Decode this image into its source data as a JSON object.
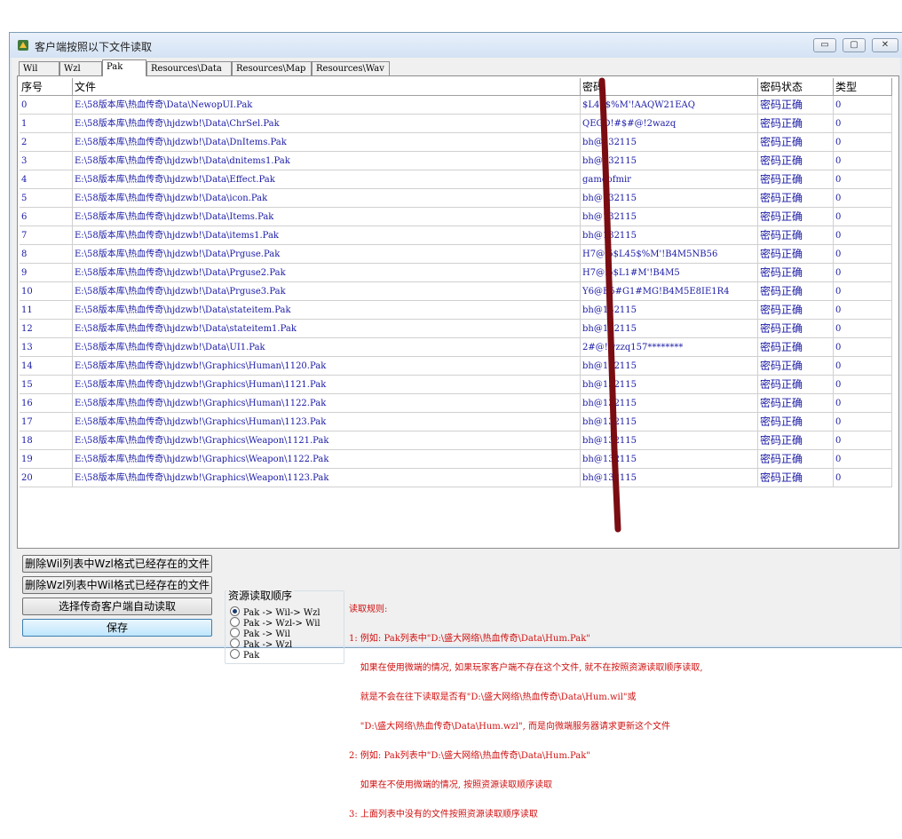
{
  "window": {
    "title": "客户端按照以下文件读取",
    "controls": {
      "minimize": "▭",
      "maximize": "▢",
      "close": "✕"
    }
  },
  "tabs": [
    {
      "label": "Wil",
      "active": false
    },
    {
      "label": "Wzl",
      "active": false
    },
    {
      "label": "Pak",
      "active": true
    },
    {
      "label": "Resources\\Data",
      "active": false
    },
    {
      "label": "Resources\\Map",
      "active": false
    },
    {
      "label": "Resources\\Wav",
      "active": false
    }
  ],
  "table": {
    "headers": [
      "序号",
      "文件",
      "密码",
      "密码状态",
      "类型"
    ],
    "rows": [
      [
        "0",
        "E:\\58版本库\\热血传奇\\Data\\NewopUI.Pak",
        "$L45$%M'!AAQW21EAQ",
        "密码正确",
        "0"
      ],
      [
        "1",
        "E:\\58版本库\\热血传奇\\hjdzwb!\\Data\\ChrSel.Pak",
        "QEGD!#$#@!2wazq",
        "密码正确",
        "0"
      ],
      [
        "2",
        "E:\\58版本库\\热血传奇\\hjdzwb!\\Data\\DnItems.Pak",
        "bh@132115",
        "密码正确",
        "0"
      ],
      [
        "3",
        "E:\\58版本库\\热血传奇\\hjdzwb!\\Data\\dnitems1.Pak",
        "bh@132115",
        "密码正确",
        "0"
      ],
      [
        "4",
        "E:\\58版本库\\热血传奇\\hjdzwb!\\Data\\Effect.Pak",
        "gameofmir",
        "密码正确",
        "0"
      ],
      [
        "5",
        "E:\\58版本库\\热血传奇\\hjdzwb!\\Data\\icon.Pak",
        "bh@132115",
        "密码正确",
        "0"
      ],
      [
        "6",
        "E:\\58版本库\\热血传奇\\hjdzwb!\\Data\\Items.Pak",
        "bh@132115",
        "密码正确",
        "0"
      ],
      [
        "7",
        "E:\\58版本库\\热血传奇\\hjdzwb!\\Data\\items1.Pak",
        "bh@132115",
        "密码正确",
        "0"
      ],
      [
        "8",
        "E:\\58版本库\\热血传奇\\hjdzwb!\\Data\\Prguse.Pak",
        "H7@.5$L45$%M'!B4M5NB56",
        "密码正确",
        "0"
      ],
      [
        "9",
        "E:\\58版本库\\热血传奇\\hjdzwb!\\Data\\Prguse2.Pak",
        "H7@.5$L1#M'!B4M5",
        "密码正确",
        "0"
      ],
      [
        "10",
        "E:\\58版本库\\热血传奇\\hjdzwb!\\Data\\Prguse3.Pak",
        "Y6@B5#G1#MG!B4M5E8IE1R4",
        "密码正确",
        "0"
      ],
      [
        "11",
        "E:\\58版本库\\热血传奇\\hjdzwb!\\Data\\stateitem.Pak",
        "bh@132115",
        "密码正确",
        "0"
      ],
      [
        "12",
        "E:\\58版本库\\热血传奇\\hjdzwb!\\Data\\stateitem1.Pak",
        "bh@132115",
        "密码正确",
        "0"
      ],
      [
        "13",
        "E:\\58版本库\\热血传奇\\hjdzwb!\\Data\\UI1.Pak",
        "2#@!wzzq157********",
        "密码正确",
        "0"
      ],
      [
        "14",
        "E:\\58版本库\\热血传奇\\hjdzwb!\\Graphics\\Human\\1120.Pak",
        "bh@132115",
        "密码正确",
        "0"
      ],
      [
        "15",
        "E:\\58版本库\\热血传奇\\hjdzwb!\\Graphics\\Human\\1121.Pak",
        "bh@132115",
        "密码正确",
        "0"
      ],
      [
        "16",
        "E:\\58版本库\\热血传奇\\hjdzwb!\\Graphics\\Human\\1122.Pak",
        "bh@132115",
        "密码正确",
        "0"
      ],
      [
        "17",
        "E:\\58版本库\\热血传奇\\hjdzwb!\\Graphics\\Human\\1123.Pak",
        "bh@132115",
        "密码正确",
        "0"
      ],
      [
        "18",
        "E:\\58版本库\\热血传奇\\hjdzwb!\\Graphics\\Weapon\\1121.Pak",
        "bh@132115",
        "密码正确",
        "0"
      ],
      [
        "19",
        "E:\\58版本库\\热血传奇\\hjdzwb!\\Graphics\\Weapon\\1122.Pak",
        "bh@132115",
        "密码正确",
        "0"
      ],
      [
        "20",
        "E:\\58版本库\\热血传奇\\hjdzwb!\\Graphics\\Weapon\\1123.Pak",
        "bh@132115",
        "密码正确",
        "0"
      ]
    ]
  },
  "buttons": {
    "delete_wil": "删除Wil列表中Wzl格式已经存在的文件",
    "delete_wzl": "删除Wzl列表中Wil格式已经存在的文件",
    "auto_read": "选择传奇客户端自动读取",
    "save": "保存"
  },
  "resource_order": {
    "title": "资源读取顺序",
    "options": [
      {
        "label": "Pak -> Wil-> Wzl",
        "selected": true
      },
      {
        "label": "Pak -> Wzl-> Wil",
        "selected": false
      },
      {
        "label": "Pak -> Wil",
        "selected": false
      },
      {
        "label": "Pak -> Wzl",
        "selected": false
      },
      {
        "label": "Pak",
        "selected": false
      }
    ]
  },
  "rules": {
    "lines": [
      "读取规则:",
      "1: 例如: Pak列表中\"D:\\盛大网络\\热血传奇\\Data\\Hum.Pak\"",
      "    如果在使用微端的情况, 如果玩家客户端不存在这个文件, 就不在按照资源读取顺序读取,",
      "    就是不会在往下读取是否有\"D:\\盛大网络\\热血传奇\\Data\\Hum.wil\"或",
      "    \"D:\\盛大网络\\热血传奇\\Data\\Hum.wzl\", 而是向微端服务器请求更新这个文件",
      "2: 例如: Pak列表中\"D:\\盛大网络\\热血传奇\\Data\\Hum.Pak\"",
      "    如果在不使用微端的情况, 按照资源读取顺序读取",
      "3: 上面列表中没有的文件按照资源读取顺序读取"
    ]
  },
  "colors": {
    "accent_text": "#1a1aa6",
    "rules_text": "#d01010",
    "annotation_stroke": "#7a0d12"
  }
}
